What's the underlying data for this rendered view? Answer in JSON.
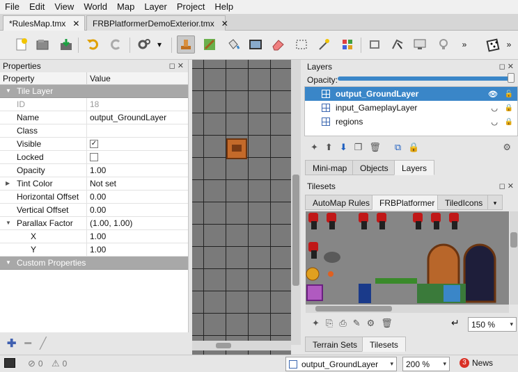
{
  "menu": [
    "File",
    "Edit",
    "View",
    "World",
    "Map",
    "Layer",
    "Project",
    "Help"
  ],
  "tabs": [
    {
      "label": "*RulesMap.tmx",
      "close": "✕"
    },
    {
      "label": "FRBPlatformerDemoExterior.tmx",
      "close": "✕"
    }
  ],
  "properties": {
    "title": "Properties",
    "col_property": "Property",
    "col_value": "Value",
    "rows": [
      {
        "key": "Tile Layer",
        "value": "",
        "group": true
      },
      {
        "key": "ID",
        "value": "18"
      },
      {
        "key": "Name",
        "value": "output_GroundLayer"
      },
      {
        "key": "Class",
        "value": ""
      },
      {
        "key": "Visible",
        "value": "✓",
        "check": true
      },
      {
        "key": "Locked",
        "value": "",
        "check": true
      },
      {
        "key": "Opacity",
        "value": "1.00"
      },
      {
        "key": "Tint Color",
        "value": "Not set",
        "arrow": true
      },
      {
        "key": "Horizontal Offset",
        "value": "0.00"
      },
      {
        "key": "Vertical Offset",
        "value": "0.00"
      },
      {
        "key": "Parallax Factor",
        "value": "(1.00, 1.00)",
        "arrow": true
      },
      {
        "key": "X",
        "value": "1.00",
        "indent": true
      },
      {
        "key": "Y",
        "value": "1.00",
        "indent": true
      },
      {
        "key": "Custom Properties",
        "value": "",
        "group": true
      }
    ]
  },
  "layers": {
    "title": "Layers",
    "opacity_label": "Opacity:",
    "opacity_value": 1.0,
    "items": [
      {
        "name": "output_GroundLayer",
        "selected": true
      },
      {
        "name": "input_GameplayLayer",
        "selected": false
      },
      {
        "name": "regions",
        "selected": false
      }
    ],
    "tabs": [
      "Mini-map",
      "Objects",
      "Layers"
    ]
  },
  "tilesets": {
    "title": "Tilesets",
    "tabs": [
      "AutoMap Rules",
      "FRBPlatformer",
      "TiledIcons"
    ],
    "zoom": "150 %",
    "bottom_tabs": [
      "Terrain Sets",
      "Tilesets"
    ]
  },
  "status": {
    "errors": "0",
    "warnings": "0",
    "layer": "output_GroundLayer",
    "zoom": "200 %",
    "news_count": "3",
    "news_label": "News"
  },
  "colors": {
    "selection": "#3a86c8",
    "canvas": "#7a7a7a",
    "group_header": "#a8a8a8"
  }
}
